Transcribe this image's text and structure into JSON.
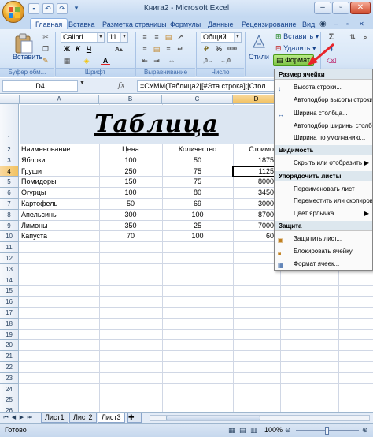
{
  "window": {
    "title": "Книга2 - Microsoft Excel"
  },
  "quick_access": {
    "save_icon": "save-icon",
    "undo_icon": "undo-icon",
    "redo_icon": "redo-icon"
  },
  "tabs": [
    {
      "label": "Главная",
      "active": true
    },
    {
      "label": "Вставка"
    },
    {
      "label": "Разметка страницы"
    },
    {
      "label": "Формулы"
    },
    {
      "label": "Данные"
    },
    {
      "label": "Рецензирование"
    },
    {
      "label": "Вид"
    }
  ],
  "ribbon": {
    "paste_label": "Вставить",
    "clipboard_group": "Буфер обм...",
    "font_name": "Calibri",
    "font_size": "11",
    "font_group": "Шрифт",
    "align_group": "Выравнивание",
    "number_format": "Общий",
    "number_group": "Число",
    "styles_label": "Стили",
    "insert_label": "Вставить",
    "delete_label": "Удалить",
    "format_label": "Формат",
    "bold": "Ж",
    "italic": "К",
    "underline": "Ч",
    "percent": "%",
    "thousands": "000"
  },
  "formula_bar": {
    "name_box": "D4",
    "fx": "fx",
    "formula": "=СУММ(Таблица2[[#Эта строка];[Стол"
  },
  "columns": [
    "A",
    "B",
    "C",
    "D"
  ],
  "rows": [
    "1",
    "2",
    "3",
    "4",
    "5",
    "6",
    "7",
    "8",
    "9",
    "10",
    "11",
    "12",
    "13",
    "14",
    "15",
    "16",
    "17",
    "18",
    "19",
    "20",
    "21",
    "22",
    "23",
    "24",
    "25",
    "26",
    "27"
  ],
  "sheet_title": "Таблица",
  "table": {
    "headers": [
      "Наименование",
      "Цена",
      "Количество",
      "Стоимо"
    ],
    "rows": [
      [
        "Яблоки",
        "100",
        "50",
        "1875"
      ],
      [
        "Груши",
        "250",
        "75",
        "1125"
      ],
      [
        "Помидоры",
        "150",
        "75",
        "8000"
      ],
      [
        "Огурцы",
        "100",
        "80",
        "3450"
      ],
      [
        "Картофель",
        "50",
        "69",
        "3000"
      ],
      [
        "Апельсины",
        "300",
        "100",
        "8700"
      ],
      [
        "Лимоны",
        "350",
        "25",
        "7000"
      ],
      [
        "Капуста",
        "70",
        "100",
        "60"
      ]
    ]
  },
  "sheets": [
    {
      "label": "Лист1"
    },
    {
      "label": "Лист2"
    },
    {
      "label": "Лист3",
      "active": true
    }
  ],
  "status": {
    "ready": "Готово",
    "zoom": "100%"
  },
  "format_menu": {
    "cell_size_header": "Размер ячейки",
    "row_height": "Высота строки...",
    "autofit_row": "Автоподбор высоты строки",
    "column_width": "Ширина столбца...",
    "autofit_column": "Автоподбор ширины столбца",
    "default_width": "Ширина по умолчанию...",
    "visibility_header": "Видимость",
    "hide_unhide": "Скрыть или отобразить",
    "organize_header": "Упорядочить листы",
    "rename_sheet": "Переименовать лист",
    "move_copy": "Переместить или скопировать",
    "tab_color": "Цвет ярлычка",
    "protection_header": "Защита",
    "protect_sheet": "Защитить лист...",
    "lock_cell": "Блокировать ячейку",
    "format_cells": "Формат ячеек..."
  },
  "colors": {
    "accent_arrow": "#e8242a",
    "format_button_highlight": "#8fd14f",
    "title_band": "#dce6f2"
  }
}
